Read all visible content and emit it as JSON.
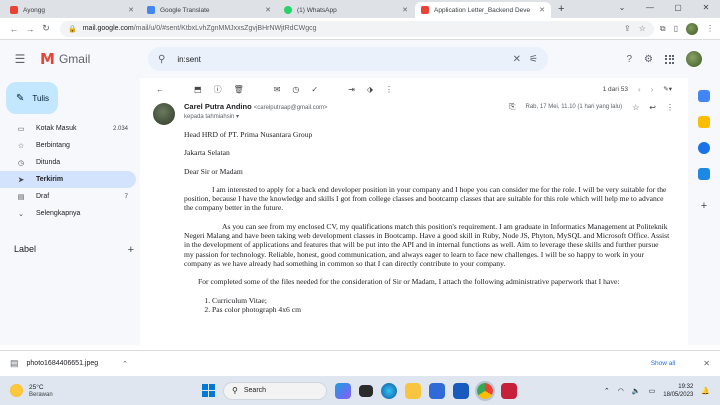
{
  "browser": {
    "tabs": [
      {
        "title": "Ayongg",
        "favicon_color": "#ea4335",
        "active": false
      },
      {
        "title": "Google Translate",
        "favicon_color": "#4285f4",
        "active": false
      },
      {
        "title": "(1) WhatsApp",
        "favicon_color": "#25d366",
        "active": false
      },
      {
        "title": "Application Letter_Backend Deve",
        "favicon_color": "#ea4335",
        "active": true
      }
    ],
    "url_host": "mail.google.com",
    "url_path": "/mail/u/0/#sent/KtbxLvhZgnMMJxxsZgvjBHrNWjtRdCWgcg"
  },
  "gmail": {
    "logo_text": "Gmail",
    "search_value": "in:sent",
    "compose_label": "Tulis",
    "nav": [
      {
        "label": "Kotak Masuk",
        "count": "2.034",
        "icon": "inbox-icon",
        "active": false
      },
      {
        "label": "Berbintang",
        "count": "",
        "icon": "star-icon",
        "active": false
      },
      {
        "label": "Ditunda",
        "count": "",
        "icon": "clock-icon",
        "active": false
      },
      {
        "label": "Terkirim",
        "count": "",
        "icon": "send-icon",
        "active": true
      },
      {
        "label": "Draf",
        "count": "7",
        "icon": "draft-icon",
        "active": false
      },
      {
        "label": "Selengkapnya",
        "count": "",
        "icon": "chevron-down-icon",
        "active": false
      }
    ],
    "labels_heading": "Label",
    "pager_text": "1 dari 53"
  },
  "message": {
    "sender_name": "Carel Putra Andino",
    "sender_email": "<carelputraap@gmail.com>",
    "to_text": "kepada tahmiahsin",
    "date_text": "Rab, 17 Mei, 11.10 (1 hari yang lalu)",
    "body": {
      "addressee": "Head HRD of PT. Prima Nusantara Group",
      "city": "Jakarta Selatan",
      "greeting": "Dear Sir or Madam",
      "para1": "I am interested to apply for a back end developer position in your company and I hope you can consider me for the role. I will be very suitable for the position, because I have the knowledge and skills I got from college classes and bootcamp classes that are suitable for this role which will help me to advance the company better in the future.",
      "para2": "As you can see from my enclosed CV, my qualifications match this position's requirement. I am graduate in Informatics Management at Politeknik Negeri Malang and have been taking web development classes in Bootcamp. Have a good skill in Ruby, Node JS, Phyton, MySQL and Microsoft Office. Assist in the development of applications and features that will be put into the API and in internal functions as well. Aim to leverage these skills and further pursue my passion for technology. Reliable, honest, good communication, and always eager to learn to face new challenges. I will be so happy to work in your company as we have already had something in common so that I can directly contribute to your company.",
      "para3": "For completed some of the files needed for the consideration of Sir or Madam, I attach the following administrative paperwork that I have:",
      "list": [
        "Curriculum Vitae;",
        "Pas color photograph 4x6 cm"
      ]
    }
  },
  "downloads": {
    "file_name": "photo1684406651.jpeg",
    "show_all": "Show all"
  },
  "taskbar": {
    "temperature": "25°C",
    "condition": "Berawan",
    "search_label": "Search",
    "time": "19:32",
    "date": "18/05/2023"
  }
}
